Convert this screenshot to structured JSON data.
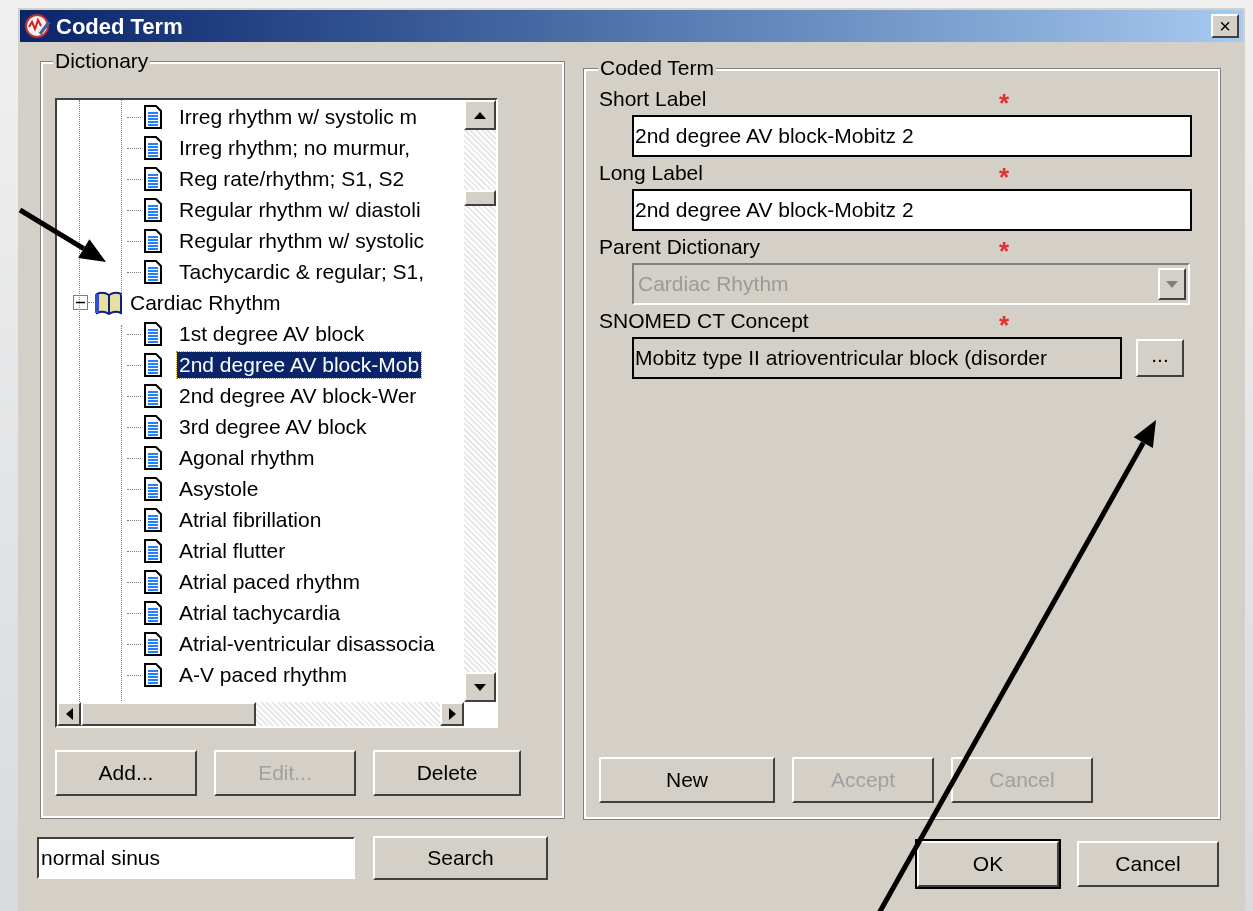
{
  "window": {
    "title": "Coded Term",
    "close": "×"
  },
  "dictionary": {
    "title": "Dictionary",
    "tree": [
      {
        "label": "Irreg rhythm w/ systolic m",
        "kind": "leaf",
        "selected": false
      },
      {
        "label": "Irreg rhythm; no murmur,",
        "kind": "leaf",
        "selected": false
      },
      {
        "label": "Reg rate/rhythm; S1, S2",
        "kind": "leaf",
        "selected": false
      },
      {
        "label": "Regular rhythm w/ diastoli",
        "kind": "leaf",
        "selected": false
      },
      {
        "label": "Regular rhythm w/ systolic",
        "kind": "leaf",
        "selected": false
      },
      {
        "label": "Tachycardic & regular; S1,",
        "kind": "leaf",
        "selected": false
      },
      {
        "label": "Cardiac Rhythm",
        "kind": "folder",
        "expanded": true,
        "selected": false,
        "children": [
          {
            "label": "1st degree AV block",
            "kind": "leaf",
            "selected": false
          },
          {
            "label": "2nd degree AV block-Mob",
            "kind": "leaf",
            "selected": true
          },
          {
            "label": "2nd degree AV block-Wer",
            "kind": "leaf",
            "selected": false
          },
          {
            "label": "3rd degree AV block",
            "kind": "leaf",
            "selected": false
          },
          {
            "label": "Agonal rhythm",
            "kind": "leaf",
            "selected": false
          },
          {
            "label": "Asystole",
            "kind": "leaf",
            "selected": false
          },
          {
            "label": "Atrial fibrillation",
            "kind": "leaf",
            "selected": false
          },
          {
            "label": "Atrial flutter",
            "kind": "leaf",
            "selected": false
          },
          {
            "label": "Atrial paced rhythm",
            "kind": "leaf",
            "selected": false
          },
          {
            "label": "Atrial tachycardia",
            "kind": "leaf",
            "selected": false
          },
          {
            "label": "Atrial-ventricular disassocia",
            "kind": "leaf",
            "selected": false
          },
          {
            "label": "A-V paced rhythm",
            "kind": "leaf",
            "selected": false
          }
        ]
      }
    ],
    "buttons": [
      {
        "label": "Add...",
        "disabled": false
      },
      {
        "label": "Edit...",
        "disabled": true
      },
      {
        "label": "Delete",
        "disabled": false
      }
    ]
  },
  "search": {
    "value": "normal sinus",
    "button": "Search"
  },
  "coded_term": {
    "title": "Coded Term",
    "fields": [
      {
        "label": "Short Label",
        "required_mark": "*",
        "kind": "text",
        "value": "2nd degree AV block-Mobitz 2",
        "disabled": false
      },
      {
        "label": "Long Label",
        "required_mark": "*",
        "kind": "text",
        "value": "2nd degree AV block-Mobitz 2",
        "disabled": false
      },
      {
        "label": "Parent Dictionary",
        "required_mark": "*",
        "kind": "dropdown",
        "value": "Cardiac Rhythm",
        "disabled": true
      },
      {
        "label": "SNOMED CT Concept",
        "required_mark": "*",
        "kind": "lookup",
        "value": "Mobitz type II atrioventricular block (disorder",
        "button": "...",
        "disabled": false
      }
    ],
    "buttons": [
      {
        "label": "New",
        "disabled": false
      },
      {
        "label": "Accept",
        "disabled": true
      },
      {
        "label": "Cancel",
        "disabled": true
      }
    ]
  },
  "footer_buttons": [
    {
      "label": "OK",
      "default": true
    },
    {
      "label": "Cancel",
      "default": false
    }
  ]
}
